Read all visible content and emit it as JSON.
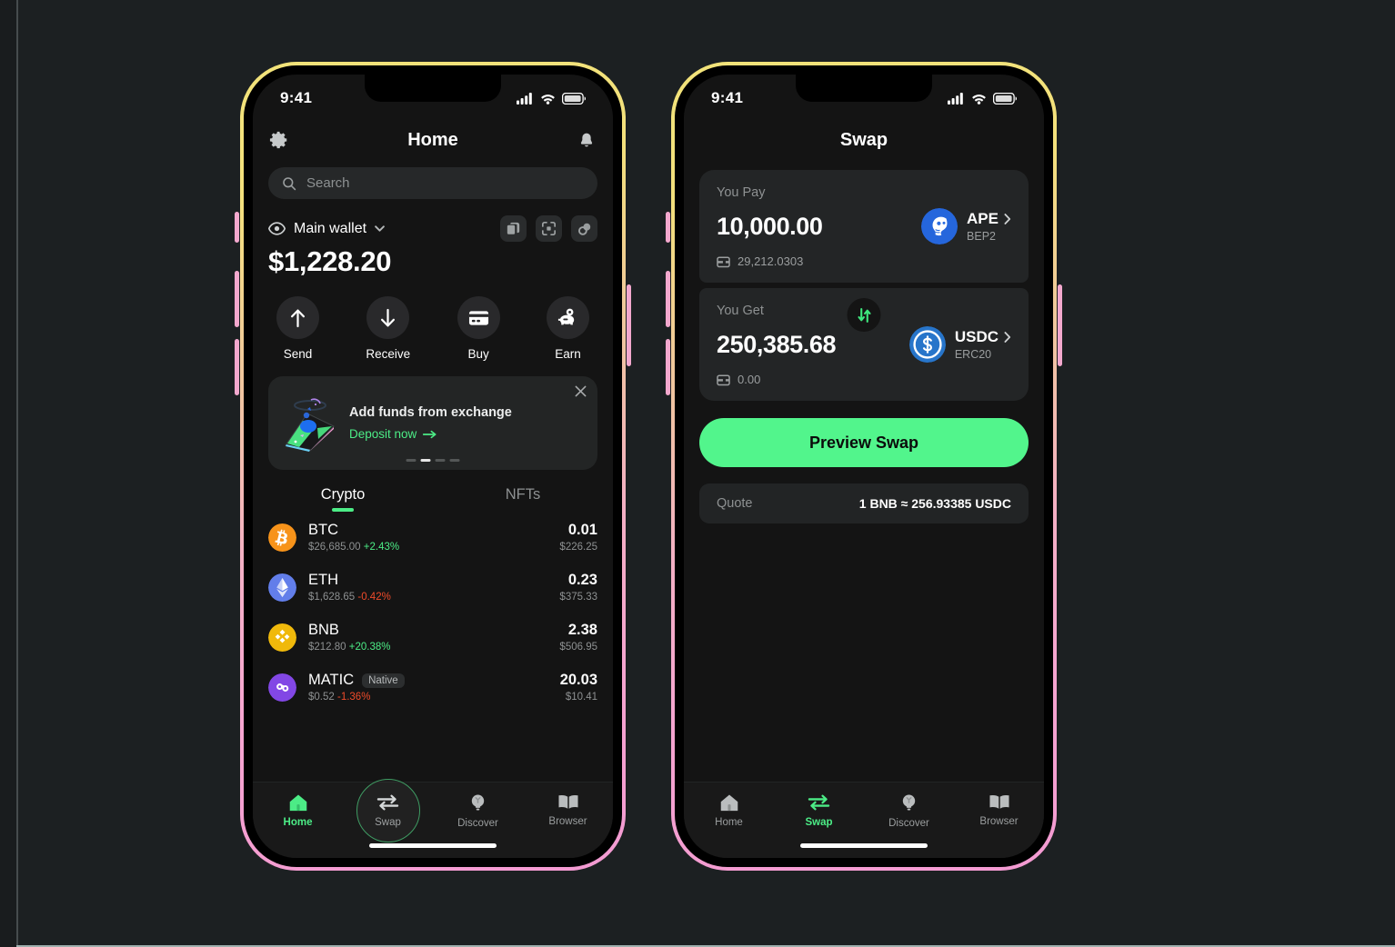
{
  "canvas": {
    "bg": "#1c2022"
  },
  "theme": {
    "accent_green": "#4cec86",
    "button_green": "#52f58c",
    "screen_bg": "#141414",
    "card_bg": "#232526",
    "up_color": "#4cec86",
    "down_color": "#ef4b2a",
    "frame_gradient_start": "#f2e37a",
    "frame_gradient_end": "#f39ad2"
  },
  "phone_home": {
    "status": {
      "time": "9:41",
      "signal_icon": "cellular-signal-icon",
      "wifi_icon": "wifi-icon",
      "battery_icon": "battery-icon"
    },
    "header": {
      "title": "Home",
      "settings_icon": "gear-icon",
      "notifications_icon": "bell-icon"
    },
    "search": {
      "placeholder": "Search",
      "value": "",
      "icon": "search-icon"
    },
    "wallet": {
      "eye_icon": "eye-icon",
      "name": "Main wallet",
      "chevron_icon": "chevron-down-icon",
      "balance": "$1,228.20",
      "actions": [
        {
          "name": "copy-address-button",
          "icon": "copy-icon"
        },
        {
          "name": "scan-qr-button",
          "icon": "scan-icon"
        },
        {
          "name": "connections-button",
          "icon": "link-icon"
        }
      ]
    },
    "quick_actions": [
      {
        "label": "Send",
        "icon": "arrow-up-icon"
      },
      {
        "label": "Receive",
        "icon": "arrow-down-icon"
      },
      {
        "label": "Buy",
        "icon": "credit-card-icon"
      },
      {
        "label": "Earn",
        "icon": "piggy-bank-icon"
      }
    ],
    "banner": {
      "title": "Add funds from exchange",
      "cta": "Deposit now",
      "cta_arrow_icon": "arrow-right-icon",
      "close_icon": "close-icon",
      "illustration": "phone-deposit-illustration",
      "dots_total": 4,
      "dots_active_index": 1
    },
    "tabs": [
      {
        "label": "Crypto",
        "active": true
      },
      {
        "label": "NFTs",
        "active": false
      }
    ],
    "assets": [
      {
        "symbol": "BTC",
        "icon": "bitcoin-icon",
        "price": "$26,685.00",
        "change": "+2.43%",
        "change_dir": "up",
        "amount": "0.01",
        "value": "$226.25",
        "badge": ""
      },
      {
        "symbol": "ETH",
        "icon": "ethereum-icon",
        "price": "$1,628.65",
        "change": "-0.42%",
        "change_dir": "down",
        "amount": "0.23",
        "value": "$375.33",
        "badge": ""
      },
      {
        "symbol": "BNB",
        "icon": "bnb-icon",
        "price": "$212.80",
        "change": "+20.38%",
        "change_dir": "up",
        "amount": "2.38",
        "value": "$506.95",
        "badge": ""
      },
      {
        "symbol": "MATIC",
        "icon": "polygon-icon",
        "price": "$0.52",
        "change": "-1.36%",
        "change_dir": "down",
        "amount": "20.03",
        "value": "$10.41",
        "badge": "Native"
      }
    ],
    "nav": [
      {
        "label": "Home",
        "icon": "home-icon",
        "active": true
      },
      {
        "label": "Swap",
        "icon": "swap-icon",
        "active": false,
        "cursor_ring": true
      },
      {
        "label": "Discover",
        "icon": "lightbulb-icon",
        "active": false
      },
      {
        "label": "Browser",
        "icon": "book-icon",
        "active": false
      }
    ]
  },
  "phone_swap": {
    "status": {
      "time": "9:41",
      "signal_icon": "cellular-signal-icon",
      "wifi_icon": "wifi-icon",
      "battery_icon": "battery-icon"
    },
    "header": {
      "title": "Swap"
    },
    "pay": {
      "legend": "You Pay",
      "amount": "10,000.00",
      "balance": "29,212.0303",
      "balance_icon": "wallet-icon",
      "token": {
        "symbol": "APE",
        "network": "BEP2",
        "icon": "ape-icon",
        "chevron_icon": "chevron-right-icon"
      }
    },
    "switch_button": {
      "name": "swap-direction-button",
      "icon": "up-down-arrows-icon"
    },
    "get": {
      "legend": "You Get",
      "amount": "250,385.68",
      "balance": "0.00",
      "balance_icon": "wallet-icon",
      "token": {
        "symbol": "USDC",
        "network": "ERC20",
        "icon": "usdc-icon",
        "chevron_icon": "chevron-right-icon"
      }
    },
    "preview_button": "Preview Swap",
    "quote": {
      "label": "Quote",
      "value": "1 BNB ≈ 256.93385 USDC"
    },
    "nav": [
      {
        "label": "Home",
        "icon": "home-icon",
        "active": false
      },
      {
        "label": "Swap",
        "icon": "swap-icon",
        "active": true
      },
      {
        "label": "Discover",
        "icon": "lightbulb-icon",
        "active": false
      },
      {
        "label": "Browser",
        "icon": "book-icon",
        "active": false
      }
    ]
  }
}
